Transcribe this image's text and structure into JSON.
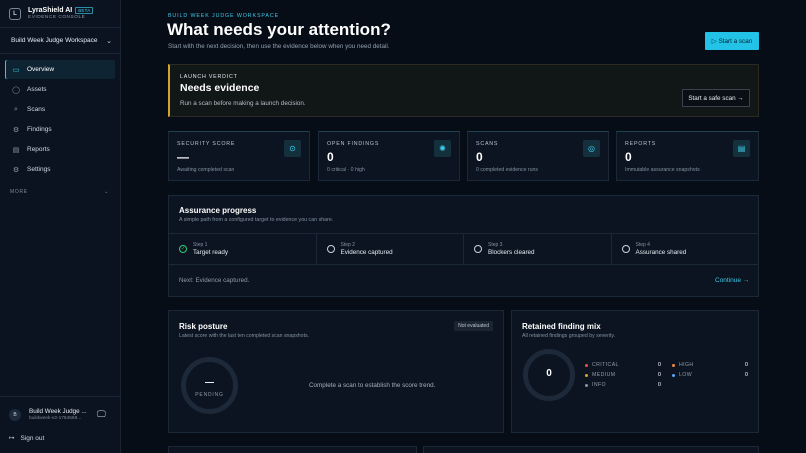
{
  "brand": {
    "logo": "L",
    "name": "LyraShield AI",
    "badge": "BETA",
    "subtitle": "EVIDENCE CONSOLE"
  },
  "workspace": {
    "name": "Build Week Judge Workspace"
  },
  "sidebar": {
    "items": [
      {
        "label": "Overview",
        "icon": "overview-icon",
        "glyph": "▭",
        "active": true
      },
      {
        "label": "Assets",
        "icon": "assets-icon",
        "glyph": "◯",
        "active": false
      },
      {
        "label": "Scans",
        "icon": "scans-icon",
        "glyph": "⌕",
        "active": false
      },
      {
        "label": "Findings",
        "icon": "findings-icon",
        "glyph": "⚙",
        "active": false
      },
      {
        "label": "Reports",
        "icon": "reports-icon",
        "glyph": "▤",
        "active": false
      },
      {
        "label": "Settings",
        "icon": "settings-icon",
        "glyph": "⚙",
        "active": false
      }
    ],
    "more_label": "MORE"
  },
  "user": {
    "initial": "B",
    "name": "Build Week Judge ...",
    "id": "buildweek-v2-1764569..."
  },
  "signout_label": "Sign out",
  "header": {
    "eyebrow": "BUILD WEEK JUDGE WORKSPACE",
    "title": "What needs your attention?",
    "subtitle": "Start with the next decision, then use the evidence below when you need detail.",
    "start_scan": "Start a scan"
  },
  "verdict": {
    "eyebrow": "LAUNCH VERDICT",
    "title": "Needs evidence",
    "subtitle": "Run a scan before making a launch decision.",
    "button": "Start a safe scan"
  },
  "stats": [
    {
      "label": "SECURITY SCORE",
      "value": "—",
      "sub": "Awaiting completed scan",
      "icon": "shield-icon",
      "glyph": "⊙"
    },
    {
      "label": "OPEN FINDINGS",
      "value": "0",
      "sub": "0 critical · 0 high",
      "icon": "bug-icon",
      "glyph": "✺"
    },
    {
      "label": "SCANS",
      "value": "0",
      "sub": "0 completed evidence runs",
      "icon": "radar-icon",
      "glyph": "◎"
    },
    {
      "label": "REPORTS",
      "value": "0",
      "sub": "Immutable assurance snapshots",
      "icon": "document-icon",
      "glyph": "▤"
    }
  ],
  "assurance": {
    "title": "Assurance progress",
    "subtitle": "A simple path from a configured target to evidence you can share.",
    "steps": [
      {
        "num": "Step 1",
        "name": "Target ready",
        "done": true
      },
      {
        "num": "Step 2",
        "name": "Evidence captured",
        "done": false
      },
      {
        "num": "Step 3",
        "name": "Blockers cleared",
        "done": false
      },
      {
        "num": "Step 4",
        "name": "Assurance shared",
        "done": false
      }
    ],
    "next": "Next: Evidence captured.",
    "continue": "Continue →"
  },
  "risk": {
    "title": "Risk posture",
    "subtitle": "Latest score with the last ten completed scan snapshots.",
    "badge": "Not evaluated",
    "gauge_value": "—",
    "gauge_label": "PENDING",
    "message": "Complete a scan to establish the score trend."
  },
  "mix": {
    "title": "Retained finding mix",
    "subtitle": "All retained findings grouped by severity.",
    "total": "0",
    "severities": [
      {
        "name": "CRITICAL",
        "value": "0",
        "color": "#e5534b"
      },
      {
        "name": "HIGH",
        "value": "0",
        "color": "#f0883e"
      },
      {
        "name": "MEDIUM",
        "value": "0",
        "color": "#d4a72c"
      },
      {
        "name": "LOW",
        "value": "0",
        "color": "#58a6ff"
      },
      {
        "name": "INFO",
        "value": "0",
        "color": "#8b949e"
      }
    ]
  },
  "colors": {
    "accent": "#22c3e6",
    "verdict_border": "#d4a428",
    "success": "#2ecc71",
    "background": "#070d16"
  }
}
